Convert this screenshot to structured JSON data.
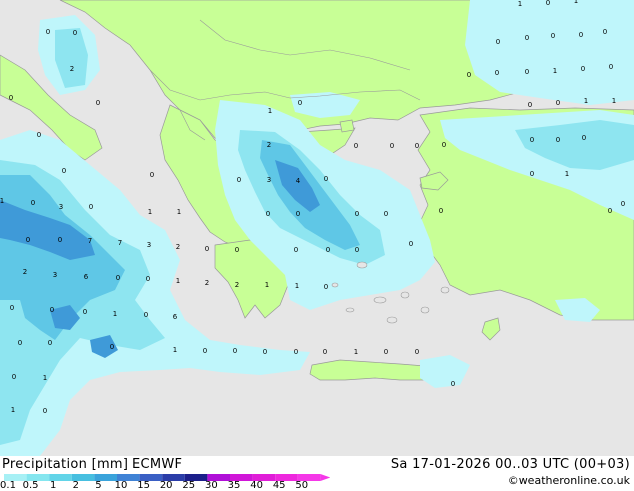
{
  "footer": {
    "title": "Precipitation [mm]",
    "model": "ECMWF",
    "datetime": "Sa 17-01-2026 00..03 UTC (00+03)",
    "credit": "©weatheronline.co.uk"
  },
  "scale": {
    "labels": [
      "0.1",
      "0.5",
      "1",
      "2",
      "5",
      "10",
      "15",
      "20",
      "25",
      "30",
      "35",
      "40",
      "45",
      "50"
    ],
    "colors": [
      "#a7f0f5",
      "#85e6ef",
      "#62d4e8",
      "#47bfe0",
      "#3aa3db",
      "#3f82d5",
      "#3a5fc4",
      "#2b3da8",
      "#1c1f8a",
      "#b010d8",
      "#d016d8",
      "#e01ed8",
      "#ee28de",
      "#f538e8"
    ]
  },
  "map": {
    "colors": {
      "sea": "#e6e6e6",
      "land": "#c8ff96",
      "precip_1": "#bff6fb",
      "precip_2": "#8ee5f0",
      "precip_3": "#5fc7e6",
      "precip_4": "#3f9ad8",
      "border": "#9a9a9a"
    },
    "value_labels": [
      {
        "t": "0"
      },
      {
        "t": "0"
      },
      {
        "t": "1"
      },
      {
        "t": "0"
      },
      {
        "t": "1"
      },
      {
        "t": "0"
      },
      {
        "t": "0"
      },
      {
        "t": "0"
      },
      {
        "t": "0"
      },
      {
        "t": "2"
      },
      {
        "t": "0"
      },
      {
        "t": "1"
      },
      {
        "t": "0"
      },
      {
        "t": "0"
      },
      {
        "t": "0"
      },
      {
        "t": "0"
      },
      {
        "t": "1"
      },
      {
        "t": "0"
      },
      {
        "t": "0"
      },
      {
        "t": "0"
      },
      {
        "t": "1"
      },
      {
        "t": "0"
      },
      {
        "t": "0"
      },
      {
        "t": "0"
      },
      {
        "t": "1"
      },
      {
        "t": "0"
      },
      {
        "t": "0"
      },
      {
        "t": "0"
      },
      {
        "t": "0"
      },
      {
        "t": "0"
      },
      {
        "t": "0"
      },
      {
        "t": "0"
      },
      {
        "t": "2"
      },
      {
        "t": "0"
      },
      {
        "t": "0"
      },
      {
        "t": "0"
      },
      {
        "t": "0"
      },
      {
        "t": "1"
      },
      {
        "t": "0"
      },
      {
        "t": "3"
      },
      {
        "t": "0"
      },
      {
        "t": "0"
      },
      {
        "t": "3"
      },
      {
        "t": "4"
      },
      {
        "t": "0"
      },
      {
        "t": "1"
      },
      {
        "t": "1"
      },
      {
        "t": "0"
      },
      {
        "t": "0"
      },
      {
        "t": "0"
      },
      {
        "t": "0"
      },
      {
        "t": "0"
      },
      {
        "t": "0"
      },
      {
        "t": "0"
      },
      {
        "t": "1"
      },
      {
        "t": "0"
      },
      {
        "t": "0"
      },
      {
        "t": "0"
      },
      {
        "t": "7"
      },
      {
        "t": "7"
      },
      {
        "t": "3"
      },
      {
        "t": "2"
      },
      {
        "t": "0"
      },
      {
        "t": "0"
      },
      {
        "t": "0"
      },
      {
        "t": "0"
      },
      {
        "t": "0"
      },
      {
        "t": "2"
      },
      {
        "t": "3"
      },
      {
        "t": "6"
      },
      {
        "t": "0"
      },
      {
        "t": "0"
      },
      {
        "t": "1"
      },
      {
        "t": "2"
      },
      {
        "t": "2"
      },
      {
        "t": "1"
      },
      {
        "t": "1"
      },
      {
        "t": "0"
      },
      {
        "t": "0"
      },
      {
        "t": "0"
      },
      {
        "t": "0"
      },
      {
        "t": "1"
      },
      {
        "t": "0"
      },
      {
        "t": "6"
      },
      {
        "t": "0"
      },
      {
        "t": "0"
      },
      {
        "t": "0"
      },
      {
        "t": "1"
      },
      {
        "t": "0"
      },
      {
        "t": "0"
      },
      {
        "t": "0"
      },
      {
        "t": "0"
      },
      {
        "t": "0"
      },
      {
        "t": "1"
      },
      {
        "t": "0"
      },
      {
        "t": "0"
      },
      {
        "t": "0"
      },
      {
        "t": "1"
      },
      {
        "t": "1"
      },
      {
        "t": "0"
      },
      {
        "t": "0"
      }
    ]
  }
}
